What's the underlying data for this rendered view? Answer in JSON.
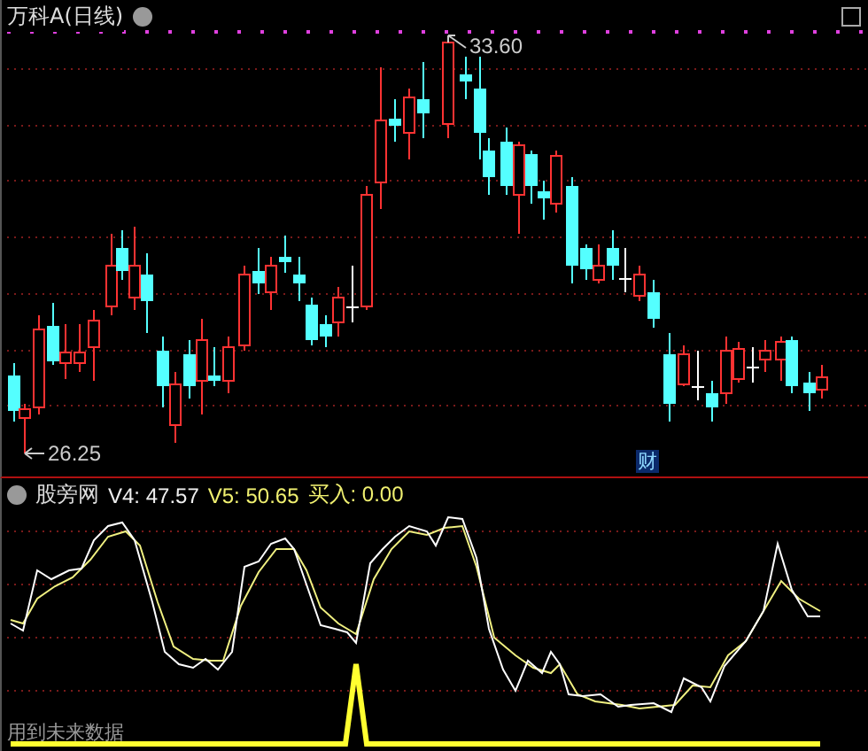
{
  "main_chart": {
    "title": "万科A(日线)",
    "high_label": "33.60",
    "low_label": "26.25",
    "event_marker": "财"
  },
  "indicator": {
    "name": "股旁网",
    "values": [
      {
        "kind": "white",
        "text": "V4: 47.57"
      },
      {
        "kind": "yellow",
        "text": "V5: 50.65"
      },
      {
        "kind": "yellow",
        "text": "买入: 0.00"
      }
    ],
    "note": "用到未来数据"
  }
}
